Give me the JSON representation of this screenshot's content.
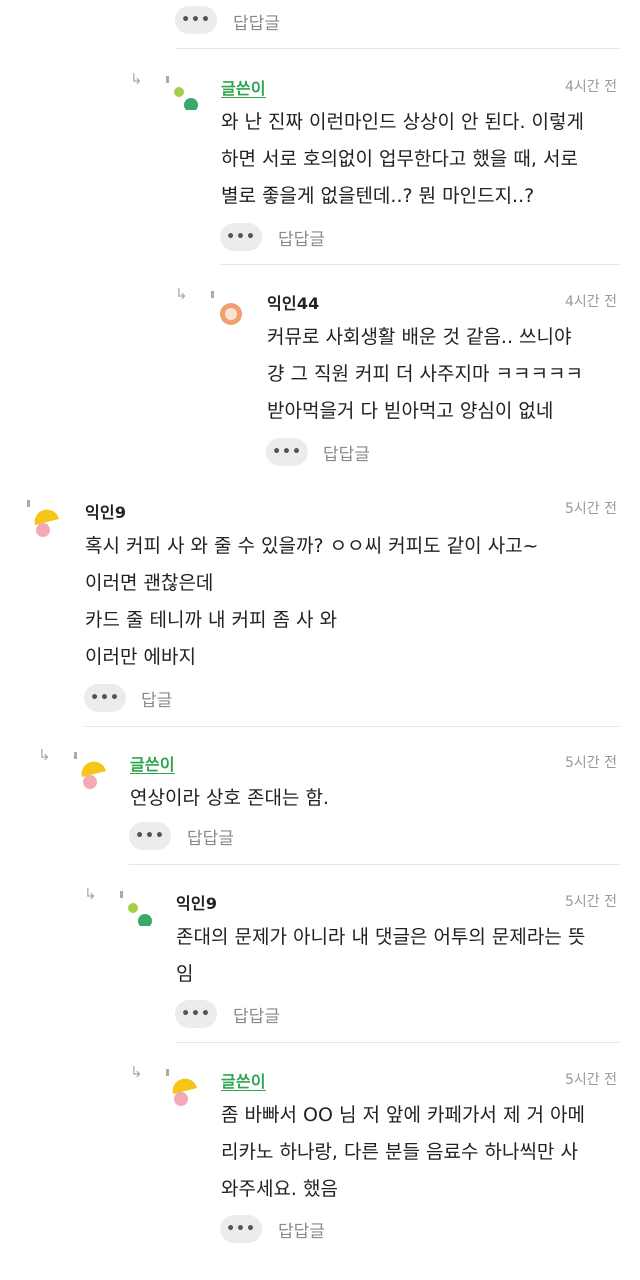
{
  "labels": {
    "reply_reply": "답답글",
    "reply": "답글",
    "more": "•••"
  },
  "comments": [
    {
      "author": "글쓴이",
      "time": "4시간 전",
      "lines": [
        "와 난 진짜 이런마인드 상상이 안 된다. 이렇게",
        "하면 서로 호의없이 업무한다고 했을 때, 서로",
        "별로 좋을게 없을텐데..? 뭔 마인드지..?"
      ]
    },
    {
      "author": "익인44",
      "time": "4시간 전",
      "lines": [
        "커뮤로 사회생활 배운 것 같음.. 쓰니야",
        "걍 그 직원 커피 더 사주지마 ㅋㅋㅋㅋㅋ",
        "받아먹을거 다 빋아먹고 양심이 없네"
      ]
    },
    {
      "author": "익인9",
      "time": "5시간 전",
      "lines": [
        "혹시 커피 사 와 줄 수 있을까? ㅇㅇ씨 커피도 같이 사고~",
        "이러면 괜찮은데",
        "카드 줄 테니까 내 커피 좀 사 와",
        "이러만 에바지"
      ]
    },
    {
      "author": "글쓴이",
      "time": "5시간 전",
      "lines": [
        "연상이라 상호 존대는 함."
      ]
    },
    {
      "author": "익인9",
      "time": "5시간 전",
      "lines": [
        "존대의 문제가 아니라 내 댓글은 어투의 문제라는 뜻",
        "임"
      ]
    },
    {
      "author": "글쓴이",
      "time": "5시간 전",
      "lines": [
        "좀 바빠서 OO 님 저 앞에 카페가서 제 거 아메",
        "리카노 하나랑, 다른 분들 음료수 하나씩만 사",
        "와주세요. 했음"
      ]
    }
  ],
  "icons": {
    "reply_arrow": "reply-arrow-icon",
    "more": "more-dots-icon"
  },
  "colors": {
    "op_name": "#2ea44f",
    "avatar_green": "#3aa86b",
    "avatar_lime": "#a6cf4a",
    "avatar_orange": "#f0a070",
    "avatar_yellow": "#f5c518",
    "avatar_pink": "#f3aab5"
  }
}
